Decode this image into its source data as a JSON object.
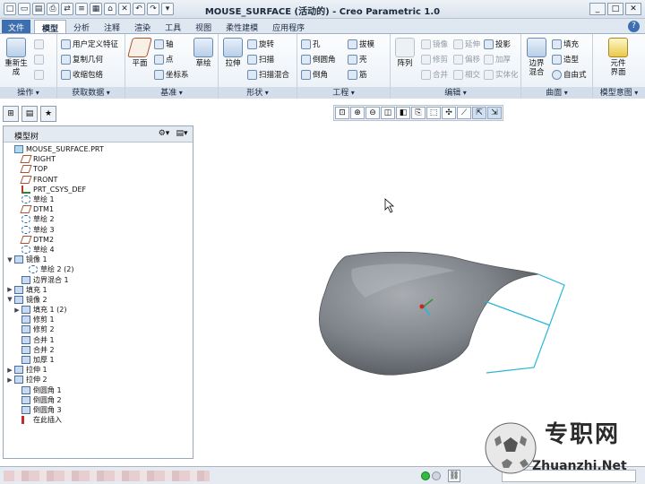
{
  "window": {
    "title": "MOUSE_SURFACE (活动的) - Creo Parametric 1.0",
    "min": "_",
    "max": "□",
    "close": "✕"
  },
  "qat": [
    "□",
    "▭",
    "▤",
    "⎙",
    "⇄",
    "≡",
    "▦",
    "⌂",
    "✕",
    "↶",
    "↷",
    "▾"
  ],
  "tabs": {
    "file": "文件",
    "items": [
      "模型",
      "分析",
      "注释",
      "渲染",
      "工具",
      "视图",
      "柔性建模",
      "应用程序"
    ],
    "active": 0,
    "help": "?"
  },
  "ribbon": {
    "operations": {
      "label": "操作",
      "regen": "重新生成",
      "copy": "",
      "paste": "",
      "delete": ""
    },
    "getdata": {
      "label": "获取数据",
      "udf": "用户定义特征",
      "copygeom": "复制几何",
      "shrinkwrap": "收缩包络"
    },
    "datum": {
      "label": "基准",
      "plane": "平面",
      "axis": "轴",
      "point": "点",
      "csys": "坐标系",
      "sketch": "草绘"
    },
    "shapes": {
      "label": "形状",
      "extrude": "拉伸",
      "revolve": "旋转",
      "sweep": "扫描",
      "sweptblend": "扫描混合"
    },
    "engineering": {
      "label": "工程",
      "hole": "孔",
      "round": "倒圆角",
      "chamfer": "倒角",
      "draft": "拔模",
      "shell": "壳",
      "rib": "筋"
    },
    "editing": {
      "label": "编辑",
      "pattern": "阵列",
      "mirror": "镜像",
      "trim": "修剪",
      "merge": "合并",
      "extend": "延伸",
      "offset": "偏移",
      "intersect": "相交",
      "project": "投影",
      "thicken": "加厚",
      "solidify": "实体化"
    },
    "surfaces": {
      "label": "曲面",
      "boundary": "边界混合",
      "fill": "填充",
      "style": "造型",
      "freestyle": "自由式"
    },
    "intent": {
      "label": "模型意图",
      "component": "元件界面"
    }
  },
  "view_toolbar": [
    "⊡",
    "⊕",
    "⊖",
    "◫",
    "◧",
    "⎘",
    "⬚",
    "✣",
    "⟋",
    "⇱",
    "⇲"
  ],
  "nav": [
    "⊞",
    "▤",
    "★"
  ],
  "tree": {
    "title": "模型树",
    "tools": [
      "⚙▾",
      "▤▾"
    ],
    "nodes": [
      {
        "label": "MOUSE_SURFACE.PRT",
        "icon": "part",
        "expander": "",
        "indent": 0
      },
      {
        "label": "RIGHT",
        "icon": "plane",
        "expander": "",
        "indent": 1
      },
      {
        "label": "TOP",
        "icon": "plane",
        "expander": "",
        "indent": 1
      },
      {
        "label": "FRONT",
        "icon": "plane",
        "expander": "",
        "indent": 1
      },
      {
        "label": "PRT_CSYS_DEF",
        "icon": "csys",
        "expander": "",
        "indent": 1
      },
      {
        "label": "草绘 1",
        "icon": "sketch",
        "expander": "",
        "indent": 1
      },
      {
        "label": "DTM1",
        "icon": "plane",
        "expander": "",
        "indent": 1
      },
      {
        "label": "草绘 2",
        "icon": "sketch",
        "expander": "",
        "indent": 1
      },
      {
        "label": "草绘 3",
        "icon": "sketch",
        "expander": "",
        "indent": 1
      },
      {
        "label": "DTM2",
        "icon": "plane",
        "expander": "",
        "indent": 1
      },
      {
        "label": "草绘 4",
        "icon": "sketch",
        "expander": "",
        "indent": 1
      },
      {
        "label": "镜像 1",
        "icon": "feat",
        "expander": "▼",
        "indent": 0
      },
      {
        "label": "草绘 2 (2)",
        "icon": "sketch",
        "expander": "",
        "indent": 2
      },
      {
        "label": "边界混合 1",
        "icon": "feat",
        "expander": "",
        "indent": 1
      },
      {
        "label": "填充 1",
        "icon": "feat",
        "expander": "▶",
        "indent": 0
      },
      {
        "label": "镜像 2",
        "icon": "feat",
        "expander": "▼",
        "indent": 0
      },
      {
        "label": "填充 1 (2)",
        "icon": "feat",
        "expander": "▶",
        "indent": 1
      },
      {
        "label": "修剪 1",
        "icon": "feat",
        "expander": "",
        "indent": 1
      },
      {
        "label": "修剪 2",
        "icon": "feat",
        "expander": "",
        "indent": 1
      },
      {
        "label": "合并 1",
        "icon": "feat",
        "expander": "",
        "indent": 1
      },
      {
        "label": "合并 2",
        "icon": "feat",
        "expander": "",
        "indent": 1
      },
      {
        "label": "加厚 1",
        "icon": "feat",
        "expander": "",
        "indent": 1
      },
      {
        "label": "拉伸 1",
        "icon": "feat",
        "expander": "▶",
        "indent": 0
      },
      {
        "label": "拉伸 2",
        "icon": "feat",
        "expander": "▶",
        "indent": 0
      },
      {
        "label": "倒圆角 1",
        "icon": "feat",
        "expander": "",
        "indent": 1
      },
      {
        "label": "倒圆角 2",
        "icon": "feat",
        "expander": "",
        "indent": 1
      },
      {
        "label": "倒圆角 3",
        "icon": "feat",
        "expander": "",
        "indent": 1
      },
      {
        "label": "在此插入",
        "icon": "insert",
        "expander": "",
        "indent": 1
      }
    ]
  },
  "status": {
    "icon": "⛓"
  },
  "watermark": {
    "text": "专职网",
    "url": "Zhuanzhi.Net"
  },
  "colors": {
    "accent": "#3d6fb0",
    "model": "#7d8288",
    "edge": "#29b6d6"
  }
}
